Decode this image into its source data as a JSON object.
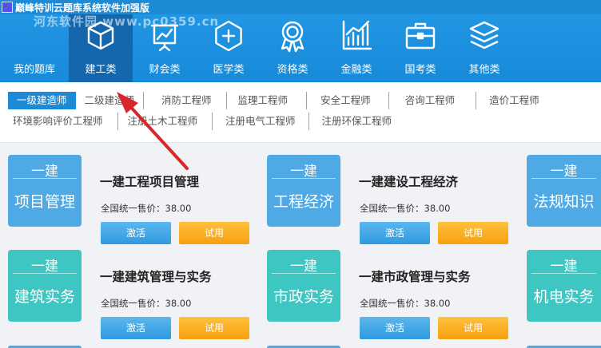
{
  "window": {
    "title": "巅峰特训云题库系统软件加强版"
  },
  "watermark": "河东软件园 www.pc0359.cn",
  "nav": [
    {
      "label": "我的题库",
      "icon": "bank-icon"
    },
    {
      "label": "建工类",
      "icon": "cube-icon"
    },
    {
      "label": "财会类",
      "icon": "chart-board-icon"
    },
    {
      "label": "医学类",
      "icon": "medical-plus-icon"
    },
    {
      "label": "资格类",
      "icon": "award-icon"
    },
    {
      "label": "金融类",
      "icon": "bar-chart-icon"
    },
    {
      "label": "国考类",
      "icon": "briefcase-icon"
    },
    {
      "label": "其他类",
      "icon": "layers-icon"
    }
  ],
  "categories_row1": [
    "一级建造师",
    "二级建造师",
    "消防工程师",
    "监理工程师",
    "安全工程师",
    "咨询工程师",
    "造价工程师"
  ],
  "categories_row2": [
    "环境影响评价工程师",
    "注册土木工程师",
    "注册电气工程师",
    "注册环保工程师"
  ],
  "cards": [
    {
      "thumb_top": "一建",
      "thumb_main": "项目管理",
      "title": "一建工程项目管理",
      "price": "全国统一售价：38.00",
      "activate": "激活",
      "trial": "试用",
      "color": "#4fa9e4"
    },
    {
      "thumb_top": "一建",
      "thumb_main": "工程经济",
      "title": "一建建设工程经济",
      "price": "全国统一售价：38.00",
      "activate": "激活",
      "trial": "试用",
      "color": "#4fa9e4"
    },
    {
      "thumb_top": "一建",
      "thumb_main": "法规知识",
      "title": "",
      "price": "",
      "activate": "",
      "trial": "",
      "color": "#4fa9e4"
    },
    {
      "thumb_top": "一建",
      "thumb_main": "建筑实务",
      "title": "一建建筑管理与实务",
      "price": "全国统一售价：38.00",
      "activate": "激活",
      "trial": "试用",
      "color": "#3ec7c2"
    },
    {
      "thumb_top": "一建",
      "thumb_main": "市政实务",
      "title": "一建市政管理与实务",
      "price": "全国统一售价：38.00",
      "activate": "激活",
      "trial": "试用",
      "color": "#3ec7c2"
    },
    {
      "thumb_top": "一建",
      "thumb_main": "机电实务",
      "title": "",
      "price": "",
      "activate": "",
      "trial": "",
      "color": "#3ec7c2"
    }
  ]
}
